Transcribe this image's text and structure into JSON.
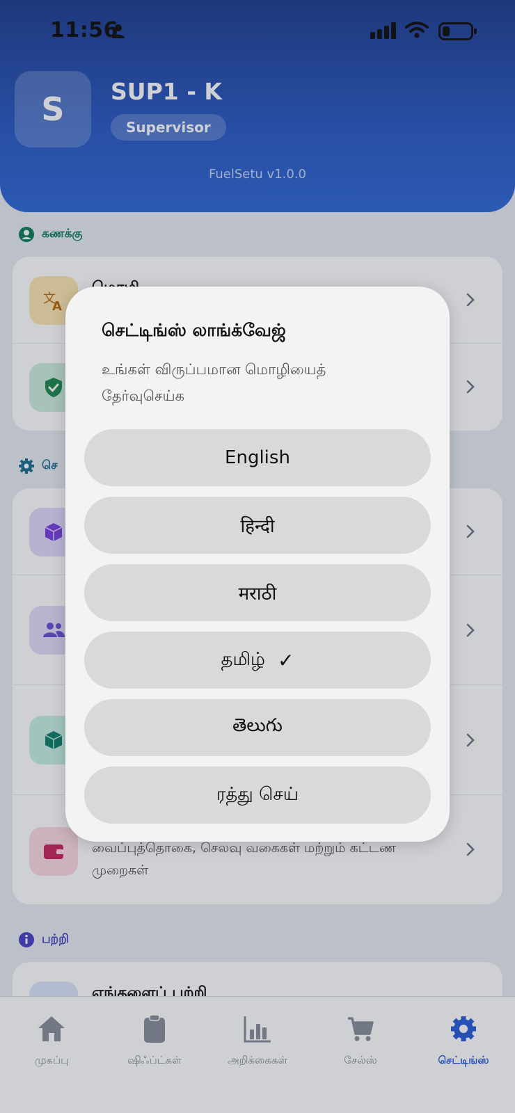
{
  "status_bar": {
    "time": "11:56"
  },
  "profile": {
    "initial": "S",
    "name": "SUP1 - K",
    "role": "Supervisor",
    "version": "FuelSetu v1.0.0"
  },
  "sections": {
    "account": {
      "title": "கணக்கு",
      "icon": "person-circle-icon",
      "color": "#0f7a5a"
    },
    "settings": {
      "title": "செ",
      "icon": "gear-icon",
      "color": "#1a6f8f"
    },
    "about": {
      "title": "பற்றி",
      "icon": "info-icon",
      "color": "#4a3fc4"
    }
  },
  "account_rows": [
    {
      "title": "மொழி",
      "icon": "translate-icon",
      "bg": "#fde7b0",
      "fg": "#b66a0f"
    },
    {
      "title": "",
      "icon": "shield-check-icon",
      "bg": "#cdeedb",
      "fg": "#1e8a4e"
    }
  ],
  "settings_rows": [
    {
      "icon": "cube-icon",
      "bg": "#e3d9fb",
      "fg": "#7a3fe0"
    },
    {
      "icon": "users-icon",
      "bg": "#e3dcf6",
      "fg": "#6b4fd4"
    },
    {
      "icon": "box-icon",
      "bg": "#c8efe4",
      "fg": "#0f7e6a"
    },
    {
      "icon": "wallet-icon",
      "bg": "#fbd9e2",
      "fg": "#c9245a",
      "desc": "வைப்புத்தொகை, செலவு வகைகள் மற்றும் கட்டண முறைகள்"
    }
  ],
  "about_rows": [
    {
      "title": "எங்களைப் பற்றி"
    }
  ],
  "bottom_nav": [
    {
      "label": "முகப்பு",
      "icon": "home-icon"
    },
    {
      "label": "ஷிஃப்ட்கள்",
      "icon": "clipboard-icon"
    },
    {
      "label": "அறிக்கைகள்",
      "icon": "bar-chart-icon"
    },
    {
      "label": "சேல்ஸ்",
      "icon": "cart-icon"
    },
    {
      "label": "செட்டிங்ஸ்",
      "icon": "gear-icon",
      "active": true
    }
  ],
  "dialog": {
    "title": "செட்டிங்ஸ் லாங்க்வேஜ்",
    "subtitle": "உங்கள் விருப்பமான மொழியைத் தேர்வுசெய்க",
    "options": [
      {
        "label": "English",
        "selected": false
      },
      {
        "label": "हिन्दी",
        "selected": false
      },
      {
        "label": "मराठी",
        "selected": false
      },
      {
        "label": "தமிழ்",
        "selected": true
      },
      {
        "label": "తెలుగు",
        "selected": false
      }
    ],
    "selected_mark": "✓",
    "cancel_label": "ரத்து செய்"
  }
}
